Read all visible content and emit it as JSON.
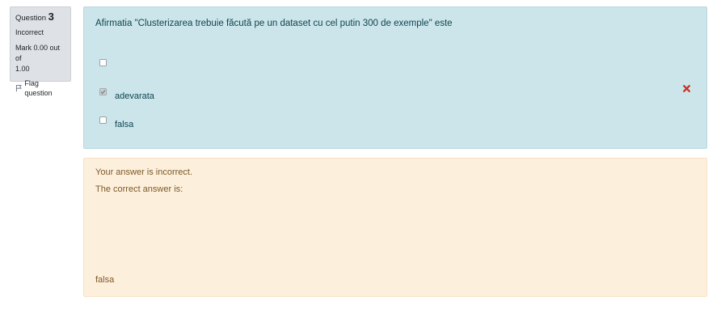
{
  "question_info": {
    "label": "Question",
    "number": "3",
    "state": "Incorrect",
    "grade_line1": "Mark 0.00 out of",
    "grade_line2": "1.00",
    "flag_label": "Flag question"
  },
  "question": {
    "text": "Afirmatia \"Clusterizarea trebuie făcută pe un dataset cu cel putin 300 de exemple\" este",
    "options": [
      {
        "label": "",
        "checked": false
      },
      {
        "label": "adevarata",
        "checked": true,
        "marked_incorrect": true
      },
      {
        "label": "falsa",
        "checked": false
      }
    ]
  },
  "feedback": {
    "result": "Your answer is incorrect.",
    "correct_intro": "The correct answer is:",
    "correct_answer": "falsa"
  },
  "icons": {
    "flag": "flag-icon",
    "incorrect": "red-x-icon",
    "checkmark": "check-icon"
  },
  "colors": {
    "info_bg": "#dee2e6",
    "question_bg": "#cce5ea",
    "feedback_bg": "#fcefdc",
    "incorrect_icon": "#ca3120"
  }
}
